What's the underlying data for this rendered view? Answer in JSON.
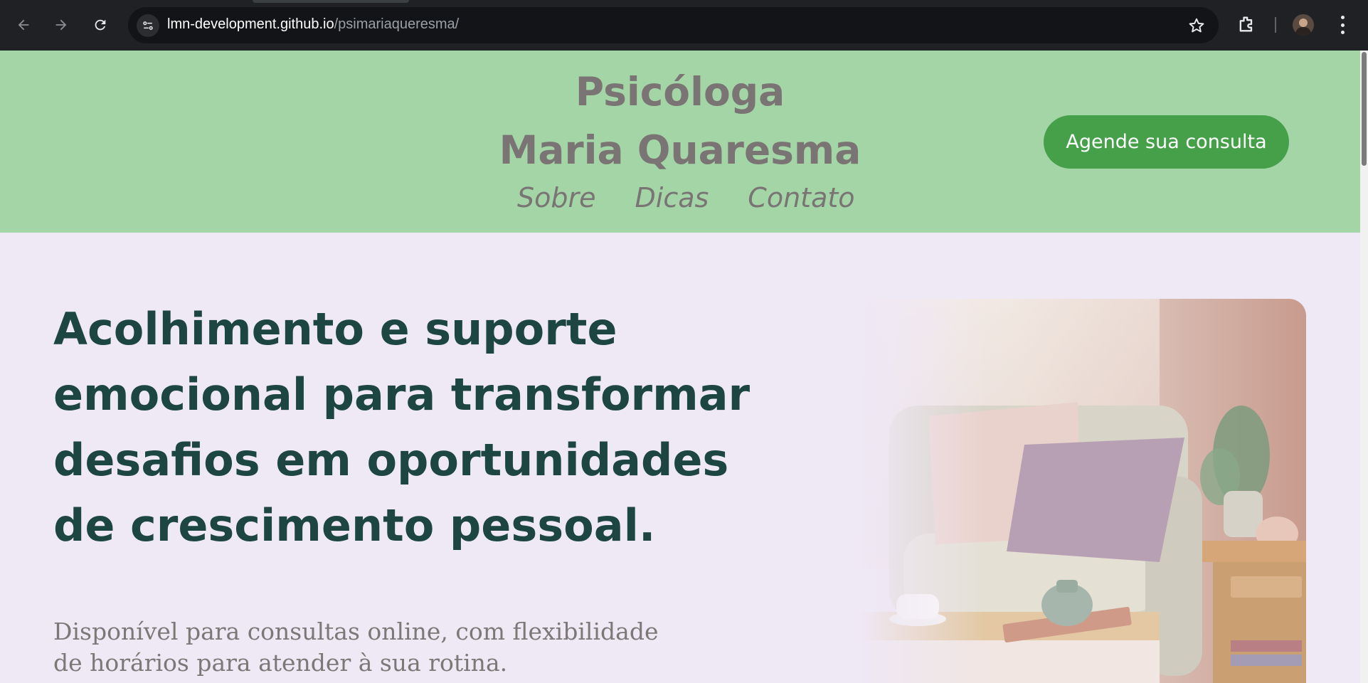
{
  "browser": {
    "url_host": "lmn-development.github.io",
    "url_path": "/psimariaqueresma/",
    "icons": [
      "back-arrow-icon",
      "forward-arrow-icon",
      "reload-icon",
      "site-info-icon",
      "bookmark-star-icon",
      "extensions-icon",
      "profile-avatar",
      "kebab-menu-icon"
    ]
  },
  "header": {
    "brand_line1": "Psicóloga",
    "brand_line2": "Maria Quaresma",
    "nav": [
      "Sobre",
      "Dicas",
      "Contato"
    ],
    "cta_label": "Agende sua consulta",
    "bg_color": "#a4d5a6",
    "cta_color": "#45a049"
  },
  "hero": {
    "title": "Acolhimento e suporte emocional para transformar desafios em oportunidades de crescimento pessoal.",
    "subtitle": "Disponível para consultas online, com flexibilidade de horários para atender à sua rotina.",
    "title_color": "#1d4541",
    "bg_color": "#efe8f5"
  }
}
